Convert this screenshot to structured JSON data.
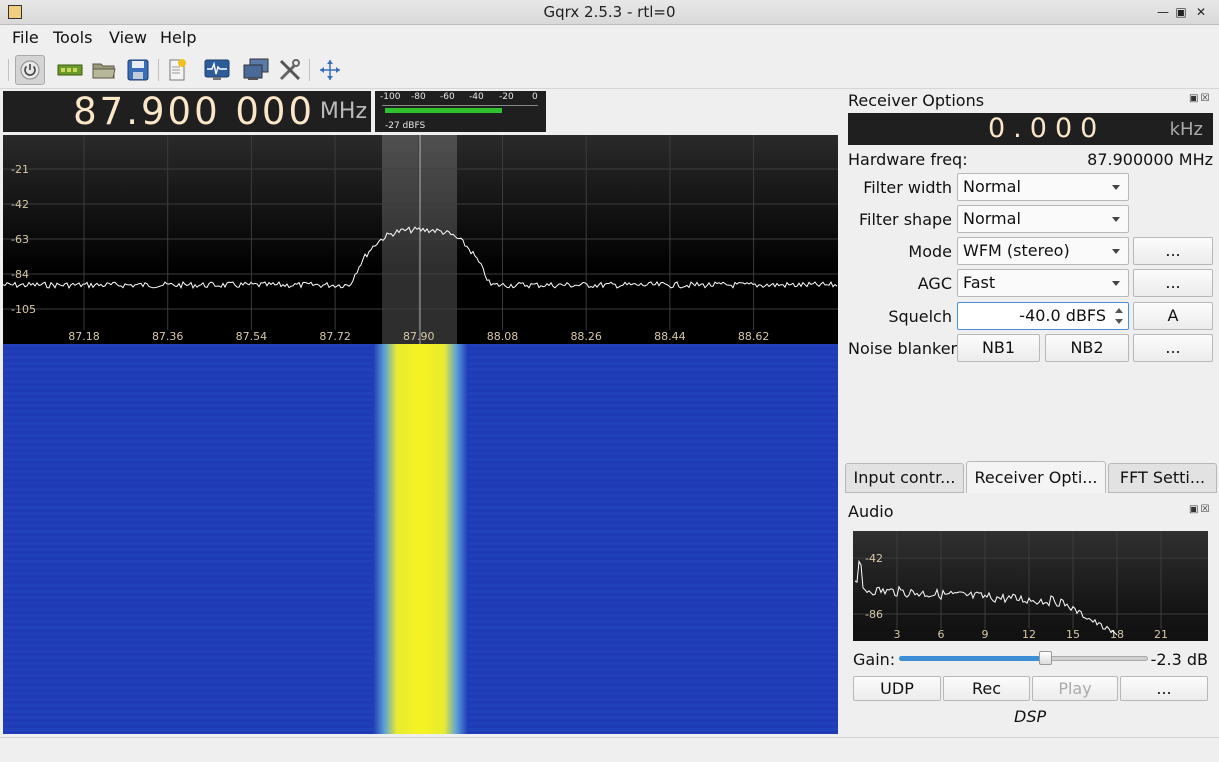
{
  "window": {
    "title": "Gqrx 2.5.3 - rtl=0"
  },
  "menu": {
    "file": "File",
    "tools": "Tools",
    "view": "View",
    "help": "Help"
  },
  "frequency": {
    "value": "87.900 000",
    "unit": "MHz"
  },
  "meter": {
    "scale": [
      "-100",
      "-80",
      "-60",
      "-40",
      "-20",
      "0"
    ],
    "level_label": "-27 dBFS"
  },
  "spectrum": {
    "y_ticks": [
      "-21",
      "-42",
      "-63",
      "-84",
      "-105"
    ],
    "x_ticks": [
      "87.18",
      "87.36",
      "87.54",
      "87.72",
      "87.90",
      "88.08",
      "88.26",
      "88.44",
      "88.62"
    ]
  },
  "receiver_options": {
    "title": "Receiver Options",
    "offset": {
      "value": "0.000",
      "unit": "kHz"
    },
    "hw_freq_label": "Hardware freq:",
    "hw_freq_value": "87.900000 MHz",
    "filter_width_label": "Filter width",
    "filter_width_value": "Normal",
    "filter_shape_label": "Filter shape",
    "filter_shape_value": "Normal",
    "mode_label": "Mode",
    "mode_value": "WFM (stereo)",
    "mode_more": "...",
    "agc_label": "AGC",
    "agc_value": "Fast",
    "agc_more": "...",
    "squelch_label": "Squelch",
    "squelch_value": "-40.0 dBFS",
    "squelch_auto": "A",
    "nb_label": "Noise blanker",
    "nb1": "NB1",
    "nb2": "NB2",
    "nb_more": "..."
  },
  "tabs": [
    "Input contr...",
    "Receiver Opti...",
    "FFT Setti..."
  ],
  "audio": {
    "title": "Audio",
    "y_ticks": [
      "-42",
      "-86"
    ],
    "x_ticks": [
      "3",
      "6",
      "9",
      "12",
      "15",
      "18",
      "21"
    ],
    "gain_label": "Gain:",
    "gain_value": "-2.3 dB",
    "gain_level": 0.59,
    "udp": "UDP",
    "rec": "Rec",
    "play": "Play",
    "more": "...",
    "dsp": "DSP"
  }
}
